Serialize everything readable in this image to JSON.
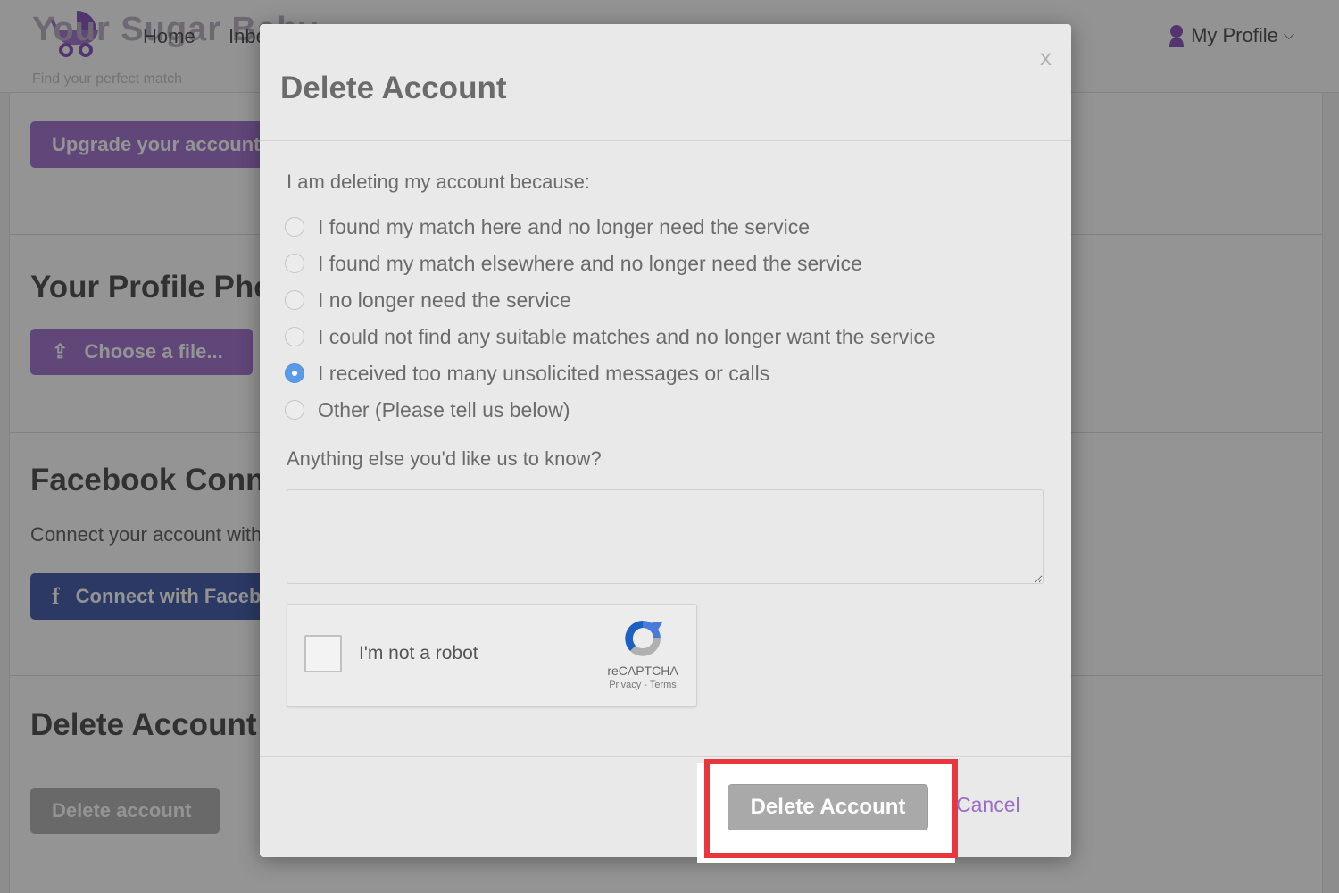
{
  "nav": {
    "brand": "Your Sugar Baby",
    "tagline": "Find your perfect match",
    "home": "Home",
    "inbox": "Inbox",
    "profile": "My Profile"
  },
  "background": {
    "upgrade_button": "Upgrade your account",
    "photo_heading": "Your Profile Photo",
    "choose_file_button": "Choose a file...",
    "facebook_heading": "Facebook Connect",
    "facebook_text": "Connect your account with Facebook",
    "facebook_button": "Connect with Facebook",
    "delete_heading": "Delete Account",
    "delete_button": "Delete account"
  },
  "modal": {
    "title": "Delete Account",
    "close": "x",
    "prompt": "I am deleting my account because:",
    "reasons": [
      {
        "label": "I found my match here and no longer need the service",
        "checked": false
      },
      {
        "label": "I found my match elsewhere and no longer need the service",
        "checked": false
      },
      {
        "label": "I no longer need the service",
        "checked": false
      },
      {
        "label": "I could not find any suitable matches and no longer want the service",
        "checked": false
      },
      {
        "label": "I received too many unsolicited messages or calls",
        "checked": true
      },
      {
        "label": "Other (Please tell us below)",
        "checked": false
      }
    ],
    "else_label": "Anything else you'd like us to know?",
    "feedback_value": "",
    "recaptcha": {
      "label": "I'm not a robot",
      "brand": "reCAPTCHA",
      "links": "Privacy - Terms"
    },
    "delete_button": "Delete Account",
    "cancel": "Cancel"
  },
  "colors": {
    "accent_purple": "#a679d0",
    "facebook_blue": "#4a62ad",
    "radio_selected": "#5a9be8",
    "highlight_red": "#e8363e"
  }
}
